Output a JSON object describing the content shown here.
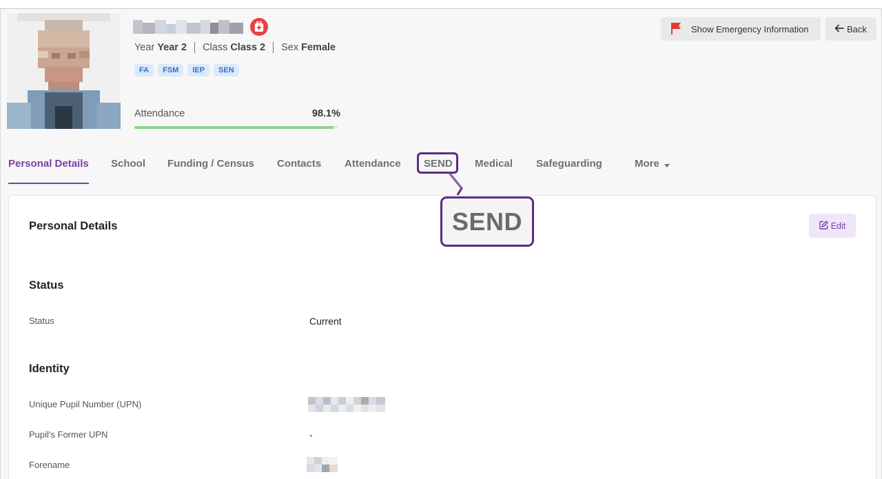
{
  "pupil": {
    "year_label": "Year",
    "year_value": "Year 2",
    "class_label": "Class",
    "class_value": "Class 2",
    "sex_label": "Sex",
    "sex_value": "Female",
    "tags": [
      "FA",
      "FSM",
      "IEP",
      "SEN"
    ],
    "attendance_label": "Attendance",
    "attendance_value": "98.1%",
    "attendance_fraction": 0.981
  },
  "actions": {
    "emergency_label": "Show Emergency Information",
    "back_label": "Back"
  },
  "tabs": [
    {
      "label": "Personal Details",
      "active": true
    },
    {
      "label": "School"
    },
    {
      "label": "Funding / Census"
    },
    {
      "label": "Contacts"
    },
    {
      "label": "Attendance"
    },
    {
      "label": "SEND",
      "highlighted": true
    },
    {
      "label": "Medical"
    },
    {
      "label": "Safeguarding"
    },
    {
      "label": "More"
    }
  ],
  "callout": {
    "text": "SEND"
  },
  "card": {
    "title": "Personal Details",
    "edit_label": "Edit",
    "sections": {
      "status_title": "Status",
      "status_label": "Status",
      "status_value": "Current",
      "identity_title": "Identity",
      "upn_label": "Unique Pupil Number (UPN)",
      "former_upn_label": "Pupil's Former UPN",
      "former_upn_value": "-",
      "forename_label": "Forename"
    }
  },
  "colors": {
    "accent": "#7a41a8",
    "callout_border": "#5b2b82",
    "tag_bg": "#dde9fa",
    "tag_text": "#2f6fd0",
    "attendance_bar": "#8ed18a",
    "medical_badge": "#e8413f",
    "flag": "#e53935"
  },
  "icons": {
    "medical": "medical-bag-icon",
    "emergency": "flag-icon",
    "back": "arrow-left-icon",
    "edit": "edit-icon",
    "more": "caret-down-icon"
  }
}
